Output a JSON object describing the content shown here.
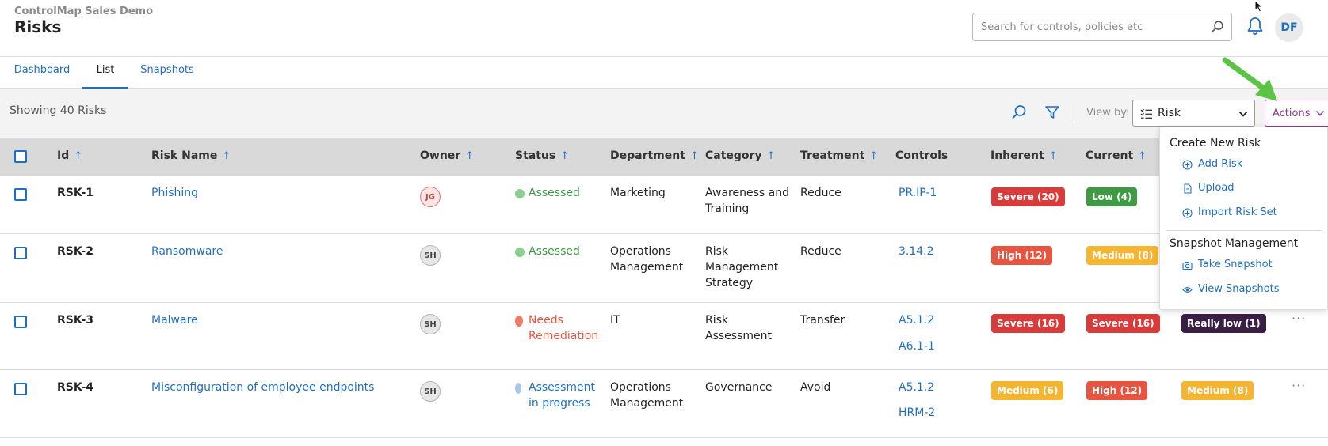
{
  "header": {
    "org_name": "ControlMap Sales Demo",
    "title": "Risks",
    "search_placeholder": "Search for controls, policies etc",
    "user_initials": "DF"
  },
  "tabs": [
    {
      "label": "Dashboard",
      "active": false
    },
    {
      "label": "List",
      "active": true
    },
    {
      "label": "Snapshots",
      "active": false
    }
  ],
  "toolbar": {
    "showing_text": "Showing 40 Risks",
    "view_by_label": "View by:",
    "view_by_value": "Risk",
    "actions_label": "Actions"
  },
  "table": {
    "columns": [
      "Id",
      "Risk Name",
      "Owner",
      "Status",
      "Department",
      "Category",
      "Treatment",
      "Controls",
      "Inherent",
      "Current"
    ],
    "rows": [
      {
        "id": "RSK-1",
        "name": "Phishing",
        "owner": "JG",
        "status": "Assessed",
        "department": "Marketing",
        "category": "Awareness and Training",
        "treatment": "Reduce",
        "controls": [
          "PR.IP-1"
        ],
        "inherent": "Severe (20)",
        "current": "Low (4)",
        "residual": ""
      },
      {
        "id": "RSK-2",
        "name": "Ransomware",
        "owner": "SH",
        "status": "Assessed",
        "department": "Operations Management",
        "category": "Risk Management Strategy",
        "treatment": "Reduce",
        "controls": [
          "3.14.2"
        ],
        "inherent": "High (12)",
        "current": "Medium (8)",
        "residual": ""
      },
      {
        "id": "RSK-3",
        "name": "Malware",
        "owner": "SH",
        "status": "Needs Remediation",
        "department": "IT",
        "category": "Risk Assessment",
        "treatment": "Transfer",
        "controls": [
          "A5.1.2",
          "A6.1-1"
        ],
        "inherent": "Severe (16)",
        "current": "Severe (16)",
        "residual": "Really low (1)"
      },
      {
        "id": "RSK-4",
        "name": "Misconfiguration of employee endpoints",
        "owner": "SH",
        "status": "Assessment in progress",
        "department": "Operations Management",
        "category": "Governance",
        "treatment": "Avoid",
        "controls": [
          "A5.1.2",
          "HRM-2"
        ],
        "inherent": "Medium (6)",
        "current": "High (12)",
        "residual": "Medium (8)"
      }
    ]
  },
  "menu": {
    "section1": "Create New Risk",
    "add_risk": "Add Risk",
    "upload": "Upload",
    "import_risk_set": "Import Risk Set",
    "section2": "Snapshot Management",
    "take_snapshot": "Take Snapshot",
    "view_snapshots": "View Snapshots"
  },
  "colors": {
    "accent": "#1f6fc0",
    "severe": "#d93b3b",
    "high": "#e8543f",
    "medium": "#f6b531",
    "low": "#3f9a44",
    "really_low": "#3a1f45",
    "assessed": "#3f9a44",
    "needs_remediation": "#e8543f",
    "in_progress": "#1f6fc0",
    "actions": "#8a3c8a",
    "annotation_arrow": "#5cc444"
  },
  "icons": [
    "search-icon",
    "bell-icon",
    "filter-icon",
    "list-icon",
    "chevron-down-icon",
    "sort-up-icon",
    "plus-circle-icon",
    "upload-icon",
    "camera-icon",
    "eye-icon",
    "more-icon",
    "cursor-icon"
  ]
}
